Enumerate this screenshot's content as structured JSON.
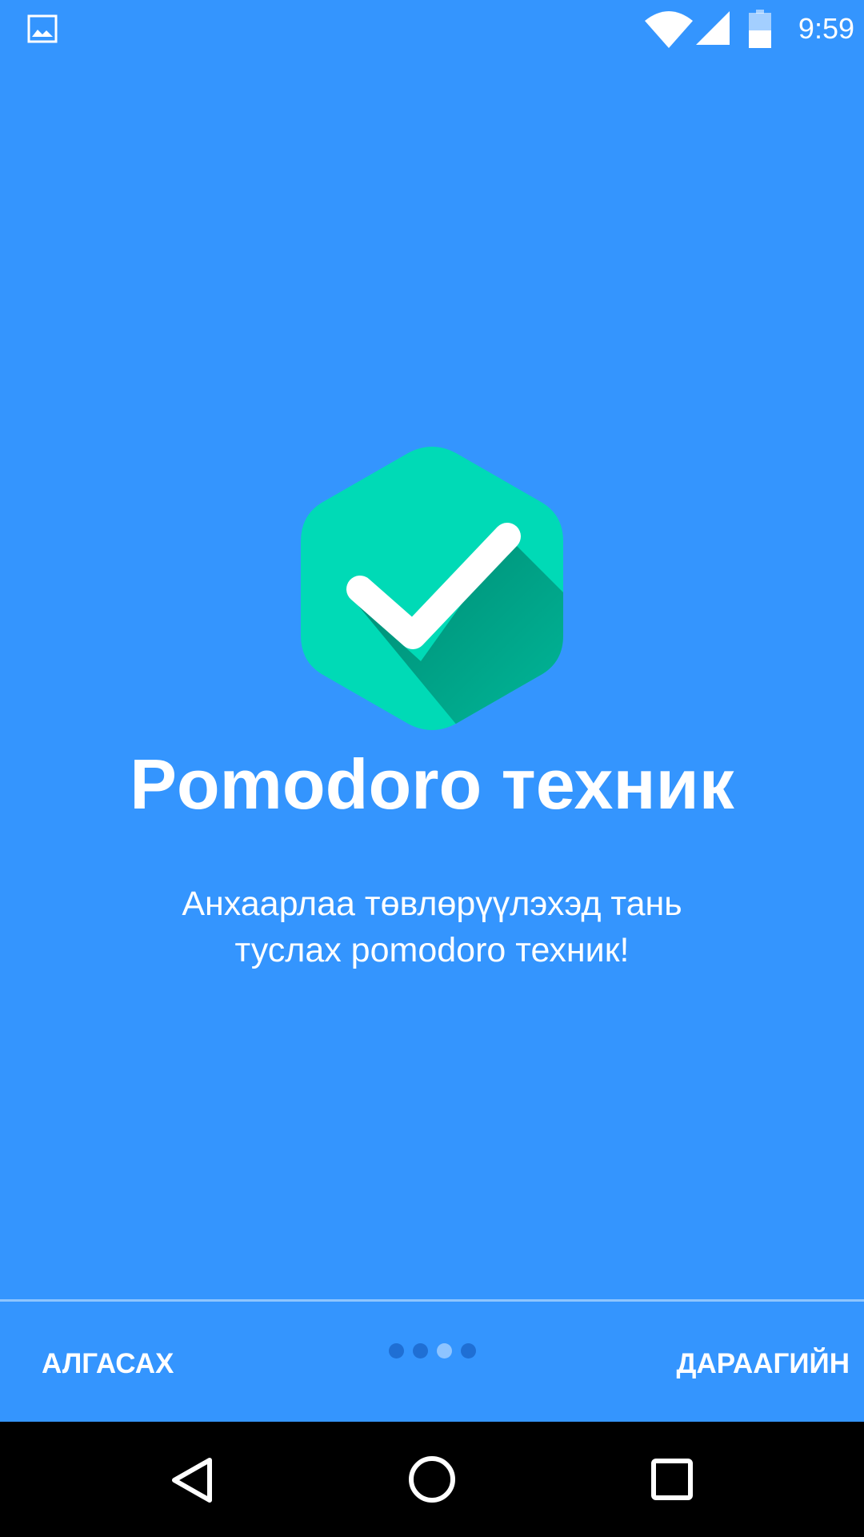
{
  "status_bar": {
    "time": "9:59",
    "icons": [
      "gallery-icon",
      "wifi-icon",
      "signal-icon",
      "battery-icon"
    ]
  },
  "onboarding": {
    "logo_icon": "checkmark-hexagon-icon",
    "title": "Pomodoro техник",
    "subtitle": "Анхаарлаа төвлөрүүлэхэд тань\nтуслах pomodoro техник!",
    "page_count": 4,
    "current_page_index": 2
  },
  "footer": {
    "skip_label": "АЛГАСАХ",
    "next_label": "ДАРААГИЙН"
  },
  "nav_bar": {
    "icons": [
      "back-icon",
      "home-icon",
      "recents-icon"
    ]
  },
  "colors": {
    "background": "#3495fe",
    "logo_primary": "#00dab6",
    "logo_shadow": "#00977e",
    "dot_inactive": "#1f6fd4",
    "dot_active": "#8ec4ff"
  }
}
